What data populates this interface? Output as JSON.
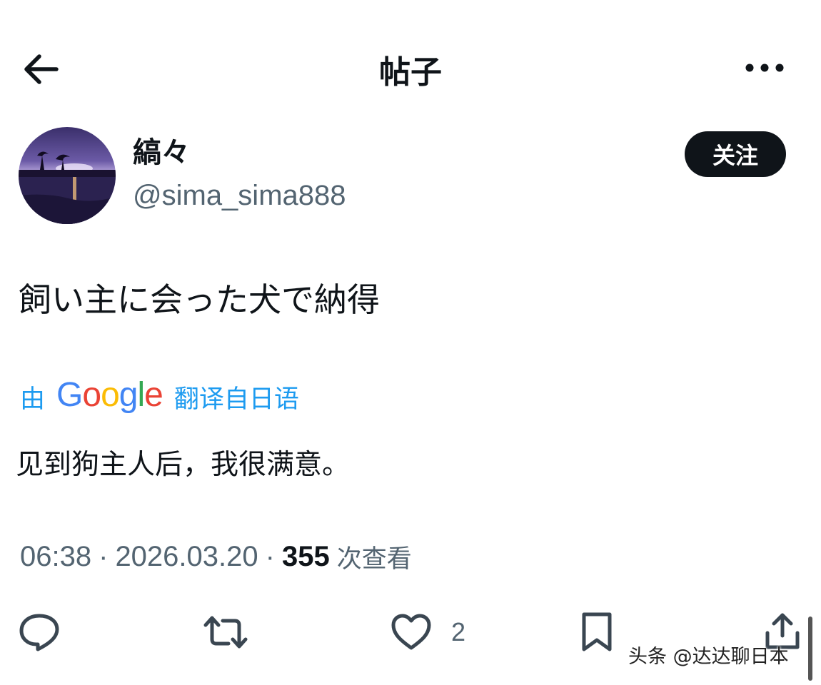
{
  "header": {
    "title": "帖子",
    "back_icon": "arrow-left-icon",
    "more_icon": "more-horizontal-icon"
  },
  "author": {
    "display_name": "縞々",
    "handle": "@sima_sima888",
    "follow_label": "关注",
    "avatar": "sunset-landscape-avatar"
  },
  "post": {
    "text": "飼い主に会った犬で納得",
    "translate_prefix": "由",
    "translate_brand": "Google",
    "translate_suffix": "翻译自日语",
    "translated_text": "见到狗主人后，我很满意。"
  },
  "meta": {
    "time": "06:38",
    "separator": "·",
    "date": "2026.03.20",
    "views_count": "355",
    "views_label": "次查看"
  },
  "actions": {
    "reply_icon": "reply-icon",
    "repost_icon": "repost-icon",
    "like_icon": "heart-icon",
    "like_count": "2",
    "bookmark_icon": "bookmark-icon",
    "share_icon": "share-icon"
  },
  "watermark": {
    "text": "头条 @达达聊日本"
  },
  "colors": {
    "text_primary": "#0f1419",
    "text_secondary": "#536471",
    "link": "#1d9bf0",
    "button_bg": "#0f1419",
    "google_blue": "#4285F4",
    "google_red": "#EA4335",
    "google_yellow": "#FBBC05",
    "google_green": "#34A853"
  }
}
